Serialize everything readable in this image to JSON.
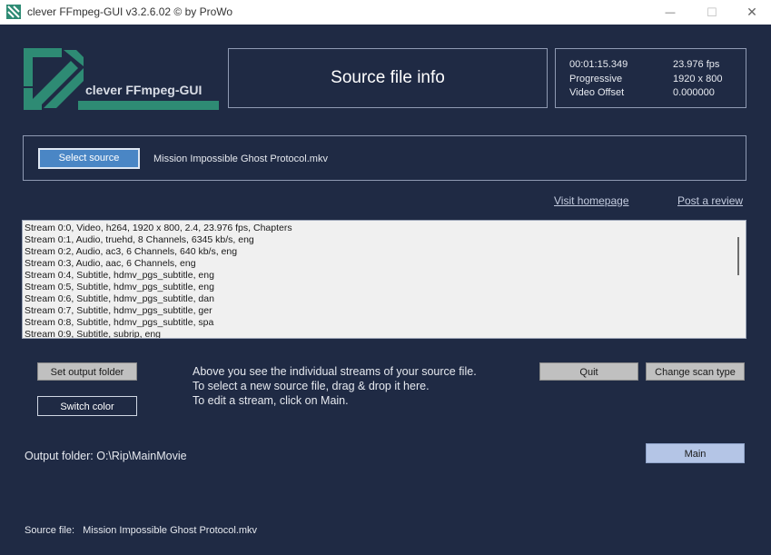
{
  "window": {
    "title": "clever FFmpeg-GUI v3.2.6.02   © by ProWo",
    "minimize": "—",
    "maximize": "☐",
    "close": "✕"
  },
  "logo": {
    "text": "clever FFmpeg-GUI",
    "color": "#2e8b74"
  },
  "info_header": {
    "title": "Source file info"
  },
  "meta": {
    "duration": "00:01:15.349",
    "fps": "23.976 fps",
    "scan_type": "Progressive",
    "resolution": "1920 x 800",
    "video_offset_label": "Video Offset",
    "video_offset": "0.000000"
  },
  "source": {
    "select_label": "Select source",
    "filename": "Mission Impossible Ghost Protocol.mkv"
  },
  "links": {
    "homepage": "Visit homepage",
    "review": "Post a review"
  },
  "streams": [
    "Stream 0:0, Video, h264, 1920 x 800, 2.4, 23.976 fps, Chapters",
    "Stream 0:1, Audio, truehd, 8 Channels, 6345 kb/s, eng",
    "Stream 0:2, Audio, ac3, 6 Channels, 640 kb/s, eng",
    "Stream 0:3, Audio, aac, 6 Channels, eng",
    "Stream 0:4, Subtitle, hdmv_pgs_subtitle, eng",
    "Stream 0:5, Subtitle, hdmv_pgs_subtitle, eng",
    "Stream 0:6, Subtitle, hdmv_pgs_subtitle, dan",
    "Stream 0:7, Subtitle, hdmv_pgs_subtitle, ger",
    "Stream 0:8, Subtitle, hdmv_pgs_subtitle, spa",
    "Stream 0:9, Subtitle, subrip, eng"
  ],
  "buttons": {
    "set_output": "Set output folder",
    "switch_color": "Switch color",
    "quit": "Quit",
    "change_scan": "Change scan type",
    "main": "Main"
  },
  "instructions": [
    "Above you see the individual streams of your source file.",
    "To select a new source file, drag & drop it here.",
    "To edit a stream, click on Main."
  ],
  "output": {
    "label": "Output folder:",
    "path": "O:\\Rip\\MainMovie"
  },
  "footer": {
    "label": "Source file:",
    "filename": "Mission Impossible Ghost Protocol.mkv"
  }
}
